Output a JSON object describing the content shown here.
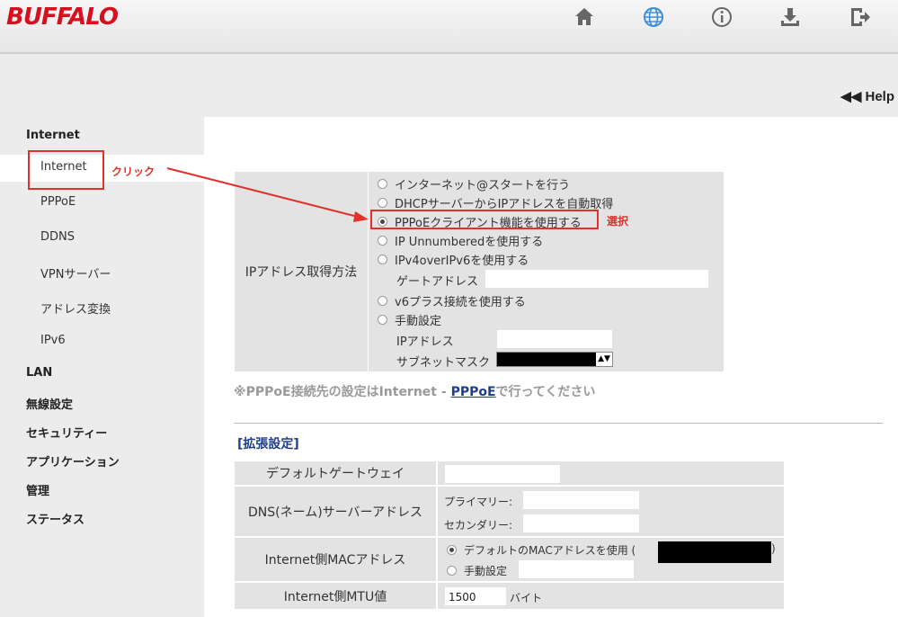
{
  "header": {
    "logo": "BUFFALO",
    "icons": [
      "home-icon",
      "globe-icon",
      "info-icon",
      "download-icon",
      "logout-icon"
    ]
  },
  "help": {
    "label": "◀◀ Help"
  },
  "sidebar": {
    "section_title": "Internet",
    "sub_items": [
      "Internet",
      "PPPoE",
      "DDNS",
      "VPNサーバー",
      "アドレス変換",
      "IPv6"
    ],
    "main_items": [
      "LAN",
      "無線設定",
      "セキュリティー",
      "アプリケーション",
      "管理",
      "ステータス"
    ]
  },
  "annotations": {
    "click_label": "クリック",
    "select_label": "選択",
    "accent_color": "#e0322a"
  },
  "ip_method": {
    "label": "IPアドレス取得方法",
    "options": [
      "インターネット@スタートを行う",
      "DHCPサーバーからIPアドレスを自動取得",
      "PPPoEクライアント機能を使用する",
      "IP Unnumberedを使用する",
      "IPv4overIPv6を使用する",
      "v6プラス接続を使用する",
      "手動設定"
    ],
    "selected_index": 2,
    "gateway_label": "ゲートアドレス",
    "ip_label": "IPアドレス",
    "subnet_label": "サブネットマスク"
  },
  "note": {
    "prefix": "※PPPoE接続先の設定はInternet - ",
    "link": "PPPoE",
    "suffix": "で行ってください"
  },
  "extended": {
    "title": "[拡張設定]",
    "default_gateway_label": "デフォルトゲートウェイ",
    "dns_label": "DNS(ネーム)サーバーアドレス",
    "dns_primary_label": "プライマリー:",
    "dns_secondary_label": "セカンダリー:",
    "mac_label": "Internet側MACアドレス",
    "mac_default_option": "デフォルトのMACアドレスを使用 (",
    "mac_default_close": ")",
    "mac_manual_option": "手動設定",
    "mtu_label": "Internet側MTU値",
    "mtu_value": "1500",
    "mtu_unit": "バイト"
  }
}
